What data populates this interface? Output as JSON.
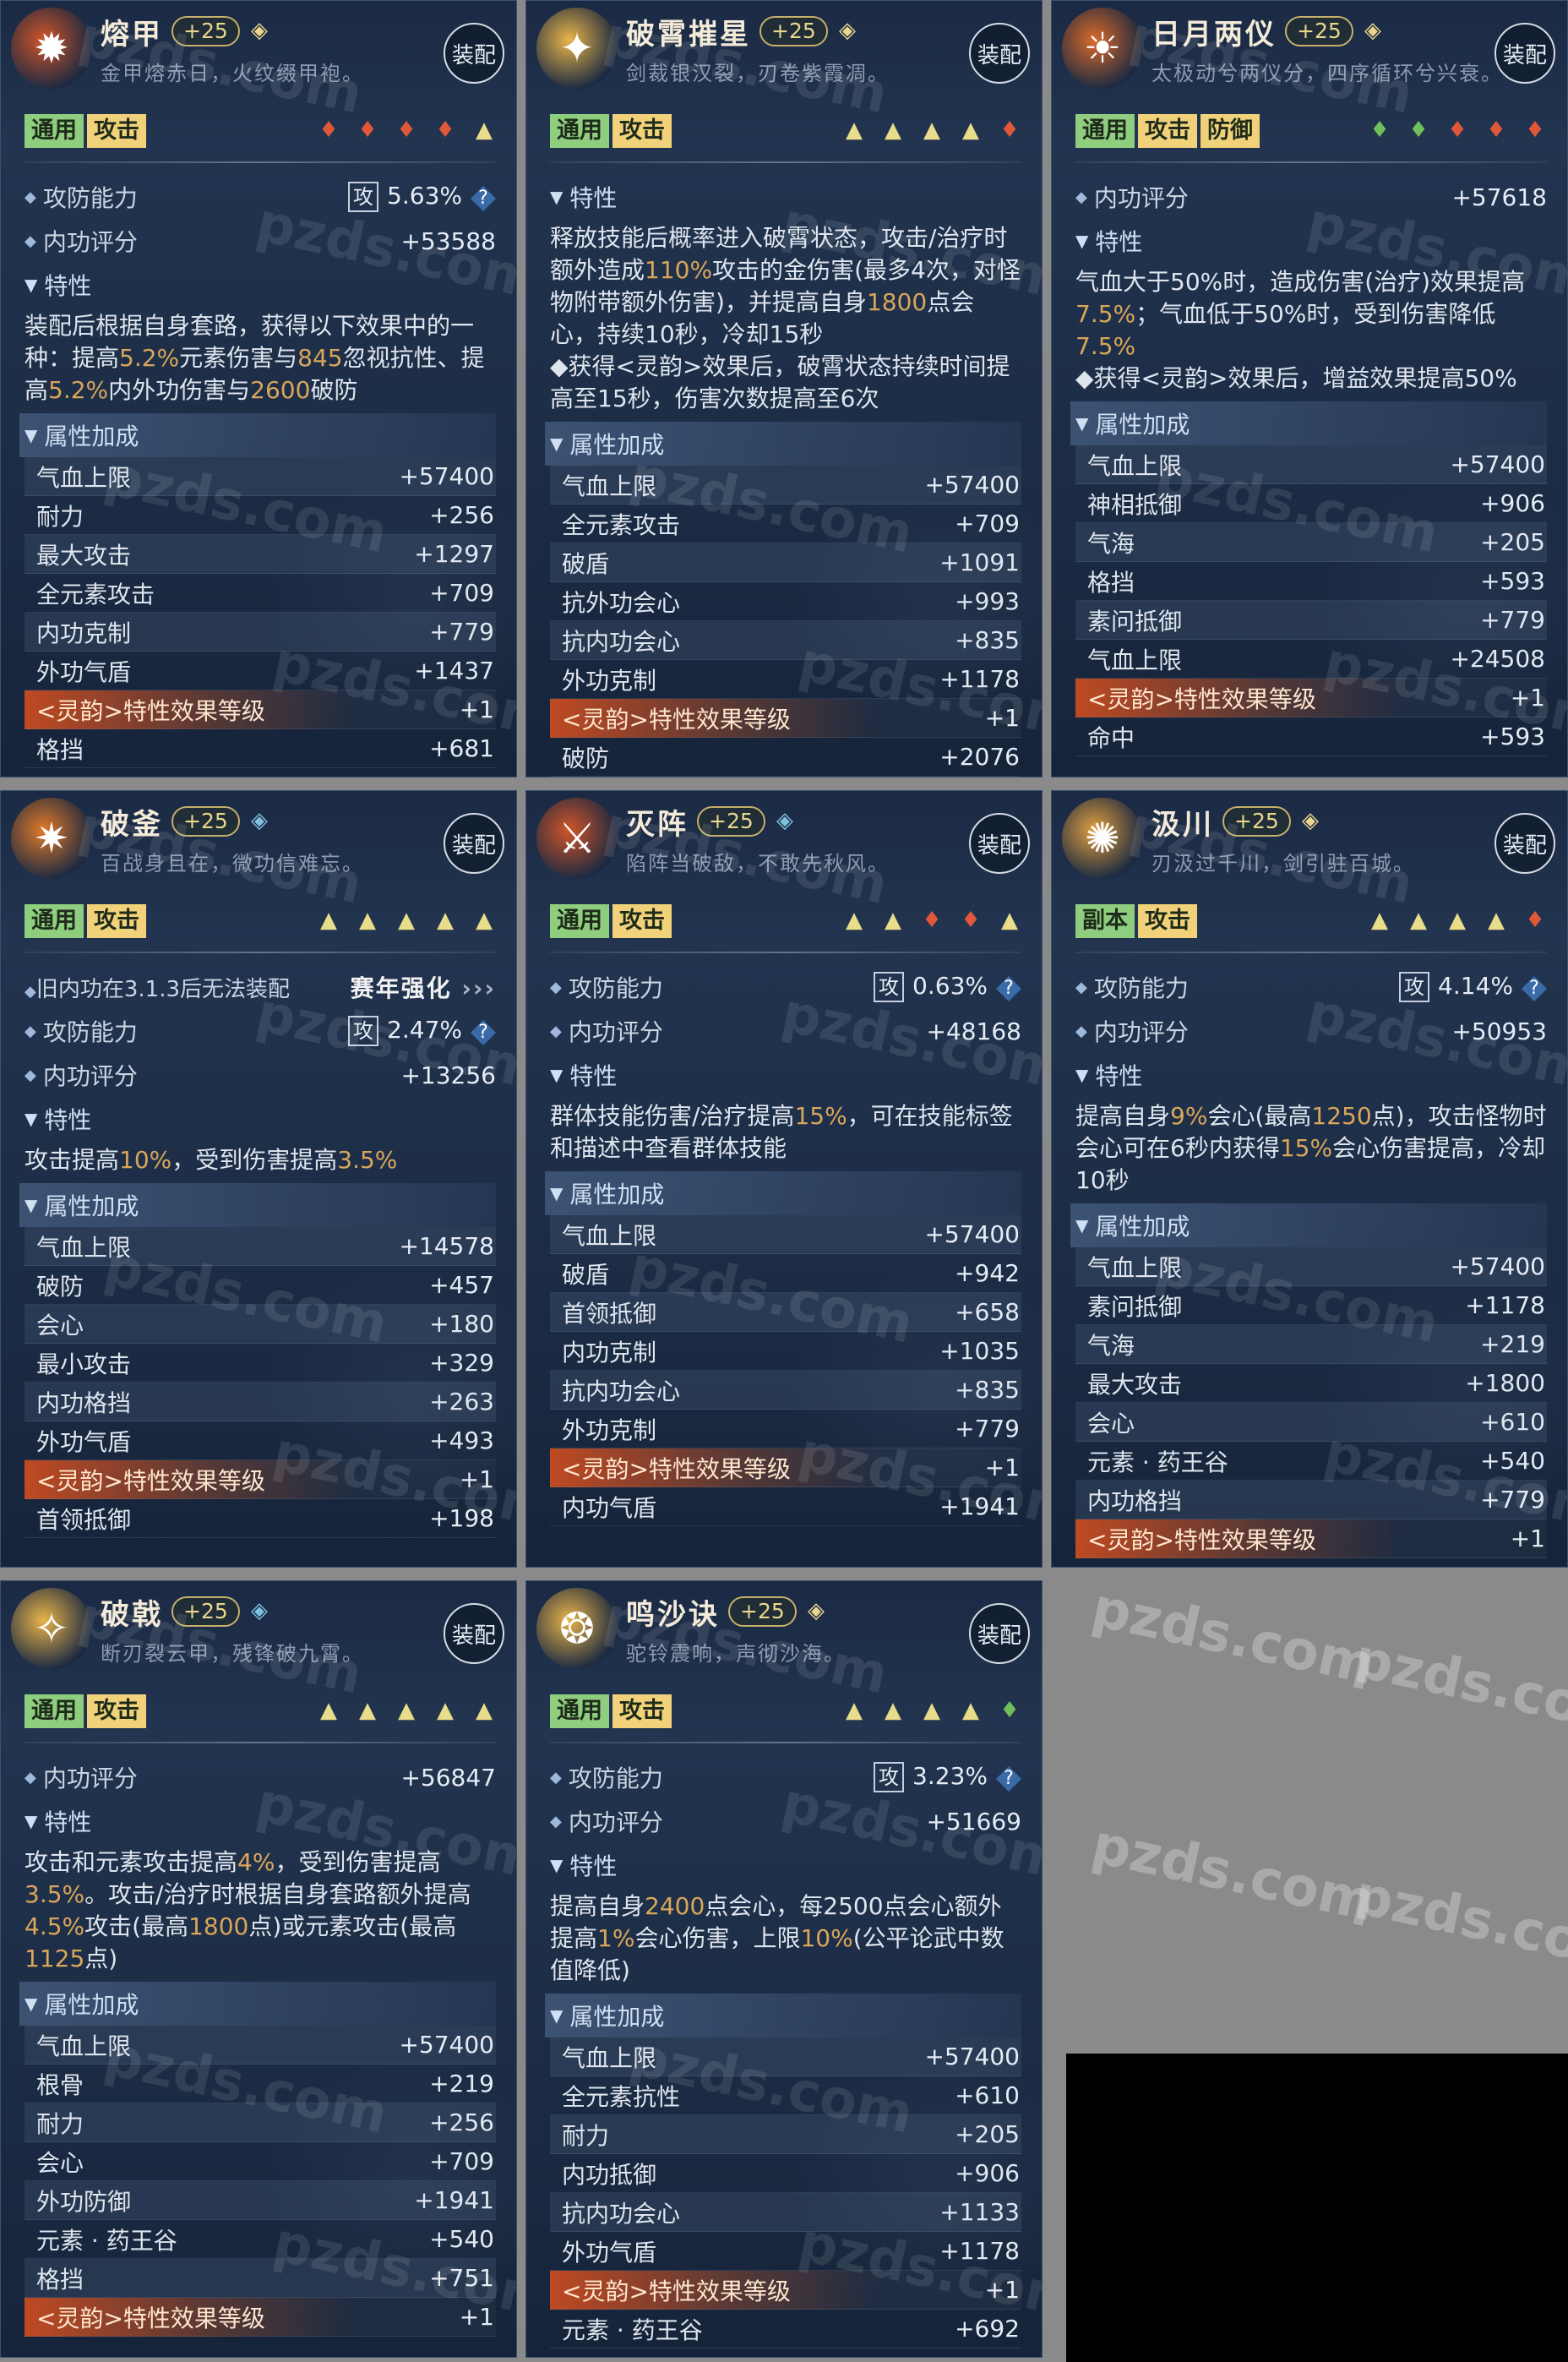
{
  "ui": {
    "equip_label": "装配",
    "trait_header": "特性",
    "bonus_header": "属性加成",
    "attack_label": "攻防能力",
    "score_label": "内功评分",
    "gong_char": "攻",
    "question_mark": "?",
    "watermark_text": "pzds.com"
  },
  "colors": {
    "background": "#8a8a8a",
    "card_bg": "#1f2f4a",
    "tag_green": "#8fce7f",
    "tag_yellow": "#f1d27a",
    "highlight": "#d9a65a",
    "lingyun_bar": "#dc5020",
    "red_flame": "#e0573a",
    "yellow_triangle": "#e9dc8a",
    "green_leaf": "#6fbf5a"
  },
  "cards": [
    {
      "name": "熔甲",
      "level": "+25",
      "subtitle": "金甲熔赤日，火纹缀甲袍。",
      "icon": "flame-armor-icon",
      "icon_color": "#d0552a",
      "gem_color": "#e8d68c",
      "tags": [
        "通用",
        "攻击"
      ],
      "flames": [
        "red",
        "red",
        "red",
        "red",
        "tri"
      ],
      "note": null,
      "attack": "5.63%",
      "score": "+53588",
      "desc_segments": [
        {
          "t": "装配后根据自身套路，获得以下效果中的一种：提高"
        },
        {
          "t": "5.2%",
          "h": true
        },
        {
          "t": "元素伤害与"
        },
        {
          "t": "845",
          "h": true
        },
        {
          "t": "忽视抗性、提高"
        },
        {
          "t": "5.2%",
          "h": true
        },
        {
          "t": "内外功伤害与"
        },
        {
          "t": "2600",
          "h": true
        },
        {
          "t": "破防"
        }
      ],
      "stats": [
        {
          "k": "气血上限",
          "v": "+57400"
        },
        {
          "k": "耐力",
          "v": "+256"
        },
        {
          "k": "最大攻击",
          "v": "+1297"
        },
        {
          "k": "全元素攻击",
          "v": "+709"
        },
        {
          "k": "内功克制",
          "v": "+779"
        },
        {
          "k": "外功气盾",
          "v": "+1437"
        },
        {
          "k": "<灵韵>特性效果等级",
          "v": "+1",
          "ling": true
        },
        {
          "k": "格挡",
          "v": "+681"
        }
      ]
    },
    {
      "name": "破霄摧星",
      "level": "+25",
      "subtitle": "剑裁银汉裂，刃卷紫霞凋。",
      "icon": "golden-blade-icon",
      "icon_color": "#e8b54a",
      "gem_color": "#e8d68c",
      "tags": [
        "通用",
        "攻击"
      ],
      "flames": [
        "tri",
        "tri",
        "tri",
        "tri",
        "red"
      ],
      "note": null,
      "attack": null,
      "score": null,
      "desc_segments": [
        {
          "t": "释放技能后概率进入破霄状态，攻击/治疗时额外造成"
        },
        {
          "t": "110%",
          "h": true
        },
        {
          "t": "攻击的金伤害(最多4次，对怪物附带额外伤害)，并提高自身"
        },
        {
          "t": "1800",
          "h": true
        },
        {
          "t": "点会心，持续10秒，冷却15秒"
        }
      ],
      "desc2": "◆获得<灵韵>效果后，破霄状态持续时间提高至15秒，伤害次数提高至6次",
      "stats": [
        {
          "k": "气血上限",
          "v": "+57400"
        },
        {
          "k": "全元素攻击",
          "v": "+709"
        },
        {
          "k": "破盾",
          "v": "+1091"
        },
        {
          "k": "抗外功会心",
          "v": "+993"
        },
        {
          "k": "抗内功会心",
          "v": "+835"
        },
        {
          "k": "外功克制",
          "v": "+1178"
        },
        {
          "k": "<灵韵>特性效果等级",
          "v": "+1",
          "ling": true
        },
        {
          "k": "破防",
          "v": "+2076"
        }
      ]
    },
    {
      "name": "日月两仪",
      "level": "+25",
      "subtitle": "太极动兮两仪分，四序循环兮兴衰。",
      "icon": "sun-moon-icon",
      "icon_color": "#d96a2a",
      "gem_color": "#e8d68c",
      "tags": [
        "通用",
        "攻击",
        "防御"
      ],
      "flames": [
        "green",
        "green",
        "red",
        "red",
        "red"
      ],
      "note": null,
      "attack": null,
      "score": "+57618",
      "desc_segments": [
        {
          "t": "气血大于50%时，造成伤害(治疗)效果提高"
        },
        {
          "t": "7.5%",
          "h": true
        },
        {
          "t": "；气血低于50%时，受到伤害降低"
        },
        {
          "t": "7.5%",
          "h": true
        }
      ],
      "desc2": "◆获得<灵韵>效果后，增益效果提高50%",
      "stats": [
        {
          "k": "气血上限",
          "v": "+57400"
        },
        {
          "k": "神相抵御",
          "v": "+906"
        },
        {
          "k": "气海",
          "v": "+205"
        },
        {
          "k": "格挡",
          "v": "+593"
        },
        {
          "k": "素问抵御",
          "v": "+779"
        },
        {
          "k": "气血上限",
          "v": "+24508"
        },
        {
          "k": "<灵韵>特性效果等级",
          "v": "+1",
          "ling": true
        },
        {
          "k": "命中",
          "v": "+593"
        }
      ]
    },
    {
      "name": "破釜",
      "level": "+25",
      "subtitle": "百战身且在，微功信难忘。",
      "icon": "broken-cauldron-icon",
      "icon_color": "#e07a2a",
      "gem_color": "#7fbfe0",
      "tags": [
        "通用",
        "攻击"
      ],
      "flames": [
        "tri",
        "tri",
        "tri",
        "tri",
        "tri"
      ],
      "note": {
        "text": "旧内功在3.1.3后无法装配",
        "right": "赛年强化"
      },
      "attack": "2.47%",
      "score": "+13256",
      "desc_segments": [
        {
          "t": "攻击提高"
        },
        {
          "t": "10%",
          "h": true
        },
        {
          "t": "，受到伤害提高"
        },
        {
          "t": "3.5%",
          "h": true
        }
      ],
      "stats": [
        {
          "k": "气血上限",
          "v": "+14578"
        },
        {
          "k": "破防",
          "v": "+457"
        },
        {
          "k": "会心",
          "v": "+180"
        },
        {
          "k": "最小攻击",
          "v": "+329"
        },
        {
          "k": "内功格挡",
          "v": "+263"
        },
        {
          "k": "外功气盾",
          "v": "+493"
        },
        {
          "k": "<灵韵>特性效果等级",
          "v": "+1",
          "ling": true
        },
        {
          "k": "首领抵御",
          "v": "+198"
        }
      ]
    },
    {
      "name": "灭阵",
      "level": "+25",
      "subtitle": "陷阵当破敌，不敢先秋风。",
      "icon": "crossed-swords-icon",
      "icon_color": "#d0552a",
      "gem_color": "#7fbfe0",
      "tags": [
        "通用",
        "攻击"
      ],
      "flames": [
        "tri",
        "tri",
        "red",
        "red",
        "tri"
      ],
      "note": null,
      "attack": "0.63%",
      "score": "+48168",
      "desc_segments": [
        {
          "t": "群体技能伤害/治疗提高"
        },
        {
          "t": "15%",
          "h": true
        },
        {
          "t": "，可在技能标签和描述中查看群体技能"
        }
      ],
      "stats": [
        {
          "k": "气血上限",
          "v": "+57400"
        },
        {
          "k": "破盾",
          "v": "+942"
        },
        {
          "k": "首领抵御",
          "v": "+658"
        },
        {
          "k": "内功克制",
          "v": "+1035"
        },
        {
          "k": "抗内功会心",
          "v": "+835"
        },
        {
          "k": "外功克制",
          "v": "+779"
        },
        {
          "k": "<灵韵>特性效果等级",
          "v": "+1",
          "ling": true
        },
        {
          "k": "内功气盾",
          "v": "+1941"
        }
      ]
    },
    {
      "name": "汲川",
      "level": "+25",
      "subtitle": "刃汲过千川，剑引驻百城。",
      "icon": "whirl-blade-icon",
      "icon_color": "#e0a040",
      "gem_color": "#e8d68c",
      "tags": [
        "副本",
        "攻击"
      ],
      "flames": [
        "tri",
        "tri",
        "tri",
        "tri",
        "red"
      ],
      "note": null,
      "attack": "4.14%",
      "score": "+50953",
      "desc_segments": [
        {
          "t": "提高自身"
        },
        {
          "t": "9%",
          "h": true
        },
        {
          "t": "会心(最高"
        },
        {
          "t": "1250",
          "h": true
        },
        {
          "t": "点)，攻击怪物时会心可在6秒内获得"
        },
        {
          "t": "15%",
          "h": true
        },
        {
          "t": "会心伤害提高，冷却10秒"
        }
      ],
      "stats": [
        {
          "k": "气血上限",
          "v": "+57400"
        },
        {
          "k": "素问抵御",
          "v": "+1178"
        },
        {
          "k": "气海",
          "v": "+219"
        },
        {
          "k": "最大攻击",
          "v": "+1800"
        },
        {
          "k": "会心",
          "v": "+610"
        },
        {
          "k": "元素 · 药王谷",
          "v": "+540"
        },
        {
          "k": "内功格挡",
          "v": "+779"
        },
        {
          "k": "<灵韵>特性效果等级",
          "v": "+1",
          "ling": true
        }
      ]
    },
    {
      "name": "破戟",
      "level": "+25",
      "subtitle": "断刃裂云甲，残锋破九霄。",
      "icon": "halberd-icon",
      "icon_color": "#e8b54a",
      "gem_color": "#7fbfe0",
      "tags": [
        "通用",
        "攻击"
      ],
      "flames": [
        "tri",
        "tri",
        "tri",
        "tri",
        "tri"
      ],
      "note": null,
      "attack": null,
      "score": "+56847",
      "desc_segments": [
        {
          "t": "攻击和元素攻击提高"
        },
        {
          "t": "4%",
          "h": true
        },
        {
          "t": "，受到伤害提高"
        },
        {
          "t": "3.5%",
          "h": true
        },
        {
          "t": "。攻击/治疗时根据自身套路额外提高"
        },
        {
          "t": "4.5%",
          "h": true
        },
        {
          "t": "攻击(最高"
        },
        {
          "t": "1800",
          "h": true
        },
        {
          "t": "点)或元素攻击(最高"
        },
        {
          "t": "1125",
          "h": true
        },
        {
          "t": "点)"
        }
      ],
      "stats": [
        {
          "k": "气血上限",
          "v": "+57400"
        },
        {
          "k": "根骨",
          "v": "+219"
        },
        {
          "k": "耐力",
          "v": "+256"
        },
        {
          "k": "会心",
          "v": "+709"
        },
        {
          "k": "外功防御",
          "v": "+1941"
        },
        {
          "k": "元素 · 药王谷",
          "v": "+540"
        },
        {
          "k": "格挡",
          "v": "+751"
        },
        {
          "k": "<灵韵>特性效果等级",
          "v": "+1",
          "ling": true
        }
      ]
    },
    {
      "name": "鸣沙诀",
      "level": "+25",
      "subtitle": "驼铃震响，声彻沙海。",
      "icon": "sand-bell-icon",
      "icon_color": "#e8b54a",
      "gem_color": "#e8d68c",
      "tags": [
        "通用",
        "攻击"
      ],
      "flames": [
        "tri",
        "tri",
        "tri",
        "tri",
        "green"
      ],
      "note": null,
      "attack": "3.23%",
      "score": "+51669",
      "desc_segments": [
        {
          "t": "提高自身"
        },
        {
          "t": "2400",
          "h": true
        },
        {
          "t": "点会心，每2500点会心额外提高"
        },
        {
          "t": "1%",
          "h": true
        },
        {
          "t": "会心伤害，上限"
        },
        {
          "t": "10%",
          "h": true
        },
        {
          "t": "(公平论武中数值降低)"
        }
      ],
      "stats": [
        {
          "k": "气血上限",
          "v": "+57400"
        },
        {
          "k": "全元素抗性",
          "v": "+610"
        },
        {
          "k": "耐力",
          "v": "+205"
        },
        {
          "k": "内功抵御",
          "v": "+906"
        },
        {
          "k": "抗内功会心",
          "v": "+1133"
        },
        {
          "k": "外功气盾",
          "v": "+1178"
        },
        {
          "k": "<灵韵>特性效果等级",
          "v": "+1",
          "ling": true
        },
        {
          "k": "元素 · 药王谷",
          "v": "+692"
        }
      ]
    }
  ]
}
